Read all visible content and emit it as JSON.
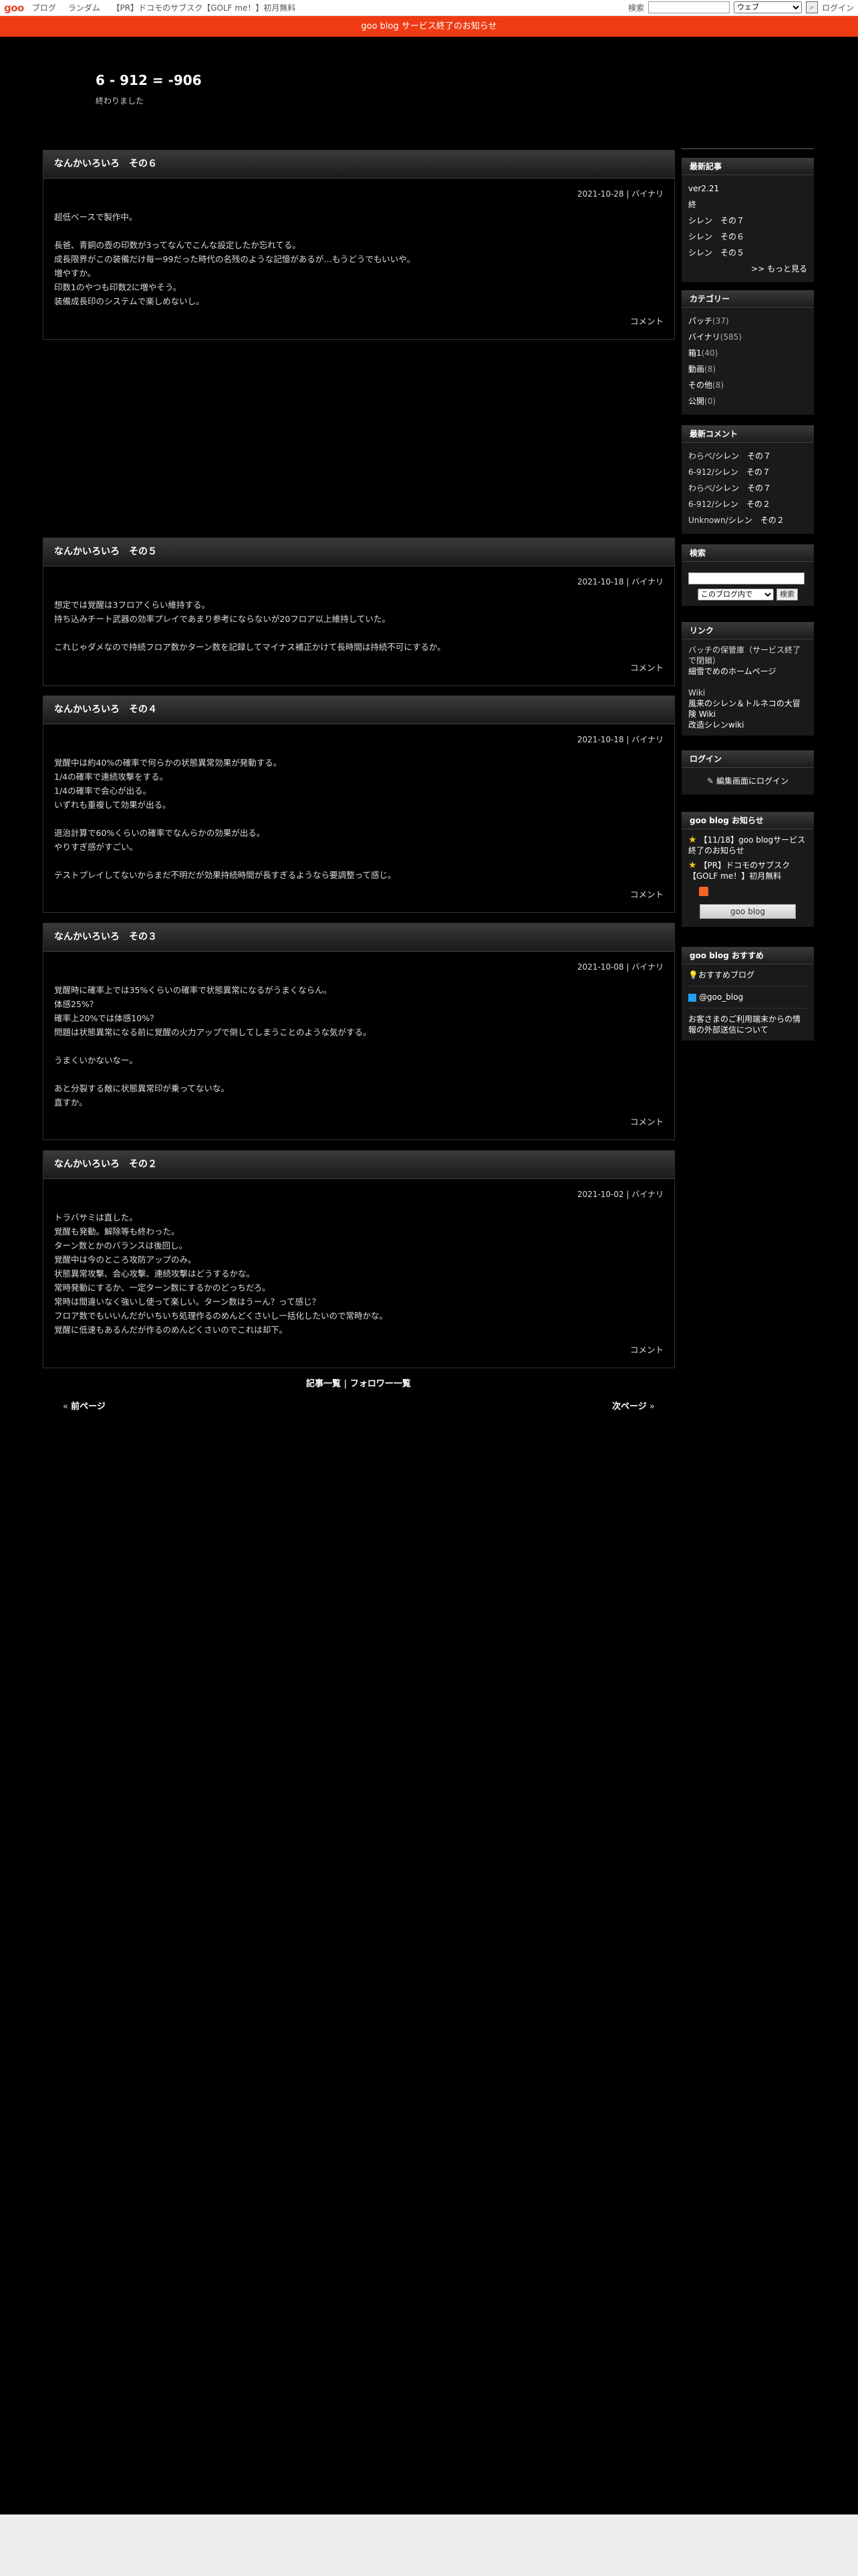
{
  "topbar": {
    "logo": "goo",
    "nav": [
      "ブログ",
      "ランダム",
      "【PR】ドコモのサブスク【GOLF me！】初月無料"
    ],
    "search_label": "検索",
    "search_scope": "ウェブ",
    "login": "ログイン"
  },
  "notice": "goo blog サービス終了のお知らせ",
  "blog": {
    "title": "6 - 912 = -906",
    "description": "終わりました"
  },
  "entries": [
    {
      "title": "なんかいろいろ　その６",
      "date": "2021-10-28 | バイナリ",
      "body": "超低ベースで製作中。\n\n長爸、青銅の壺の印数が3ってなんでこんな設定したか忘れてる。\n成長限界がこの装備だけ毎ー99だった時代の名残のような記憶があるが…もうどうでもいいや。\n増やすか。\n印数1のやつも印数2に増やそう。\n装備成長印のシステムで楽しめないし。",
      "comment": "コメント"
    },
    {
      "title": "なんかいろいろ　その５",
      "date": "2021-10-18 | バイナリ",
      "body": "想定では覚醒は3フロアくらい維持する。\n持ち込みチート武器の効率プレイであまり参考にならないが20フロア以上維持していた。\n\nこれじゃダメなので持続フロア数かターン数を記録してマイナス補正かけて長時間は持続不可にするか。",
      "comment": "コメント"
    },
    {
      "title": "なんかいろいろ　その４",
      "date": "2021-10-18 | バイナリ",
      "body": "覚醒中は約40%の確率で何らかの状態異常効果が発動する。\n1/4の確率で連続攻撃をする。\n1/4の確率で会心が出る。\nいずれも重複して効果が出る。\n\n退治計算で60%くらいの確率でなんらかの効果が出る。\nやりすぎ感がすごい。\n\nテストプレイしてないからまだ不明だが効果持続時間が長すぎるようなら要調整って感じ。",
      "comment": "コメント"
    },
    {
      "title": "なんかいろいろ　その３",
      "date": "2021-10-08 | バイナリ",
      "body": "覚醒時に確率上では35%くらいの確率で状態異常になるがうまくならん。\n体感25%？\n確率上20%では体感10%？\n問題は状態異常になる前に覚醒の火力アップで倒してしまうことのような気がする。\n\nうまくいかないなー。\n\nあと分裂する敵に状態異常印が乗ってないな。\n直すか。",
      "comment": "コメント"
    },
    {
      "title": "なんかいろいろ　その２",
      "date": "2021-10-02 | バイナリ",
      "body": "トラバサミは直した。\n覚醒も発動。解除等も終わった。\nターン数とかのバランスは後回し。\n覚醒中は今のところ攻防アップのみ。\n状態異常攻撃、会心攻撃、連続攻撃はどうするかな。\n常時発動にするか、一定ターン数にするかのどっちだろ。\n常時は間違いなく強いし使って楽しい。ターン数はうーん？って感じ？\nフロア数でもいいんだがいちいち処理作るのめんどくさいし一括化したいので常時かな。\n覚醒に低速もあるんだが作るのめんどくさいのでこれは却下。",
      "comment": "コメント"
    }
  ],
  "pager": {
    "archive": "記事一覧",
    "followers": "フォロワー一覧",
    "sep": "|",
    "prev": "前ページ",
    "next": "次ページ"
  },
  "sidebar": {
    "recent": {
      "head": "最新記事",
      "items": [
        "ver2.21",
        "終",
        "シレン　その７",
        "シレン　その６",
        "シレン　その５"
      ],
      "more": ">> もっと見る"
    },
    "categories": {
      "head": "カテゴリー",
      "items": [
        {
          "name": "パッチ",
          "count": "(37)"
        },
        {
          "name": "バイナリ",
          "count": "(585)"
        },
        {
          "name": "箱1",
          "count": "(40)"
        },
        {
          "name": "動画",
          "count": "(8)"
        },
        {
          "name": "その他",
          "count": "(8)"
        },
        {
          "name": "公開",
          "count": "(0)"
        }
      ]
    },
    "comments": {
      "head": "最新コメント",
      "items": [
        {
          "user": "わらべ",
          "post": "シレン　その７"
        },
        {
          "user": "6-912",
          "post": "シレン　その７"
        },
        {
          "user": "わらべ",
          "post": "シレン　その７"
        },
        {
          "user": "6-912",
          "post": "シレン　その２"
        },
        {
          "user": "Unknown",
          "post": "シレン　その２"
        }
      ]
    },
    "search": {
      "head": "検索",
      "scope": "このブログ内で",
      "button": "検索"
    },
    "links": {
      "head": "リンク",
      "items": [
        {
          "text": "バッチの保管庫（サービス終了で閉鎖）",
          "link": false
        },
        {
          "text": "細雪でめのホームページ",
          "link": true
        },
        {
          "text": "Wiki",
          "link": false
        },
        {
          "text": "風来のシレン＆トルネコの大冒険 Wiki",
          "link": true
        },
        {
          "text": "改造シレンwiki",
          "link": true
        }
      ]
    },
    "login": {
      "head": "ログイン",
      "link": "編集画面にログイン"
    },
    "goo_notice": {
      "head": "goo blog お知らせ",
      "items": [
        "【11/18】goo blogサービス終了のお知らせ",
        "【PR】ドコモのサブスク【GOLF me！】初月無料"
      ],
      "button": "goo blog"
    },
    "recommend": {
      "head": "goo blog おすすめ",
      "item": "おすすめブログ",
      "twitter": "@goo_blog",
      "inquiry": "お客さまのご利用端末からの情報の外部送信について"
    }
  }
}
